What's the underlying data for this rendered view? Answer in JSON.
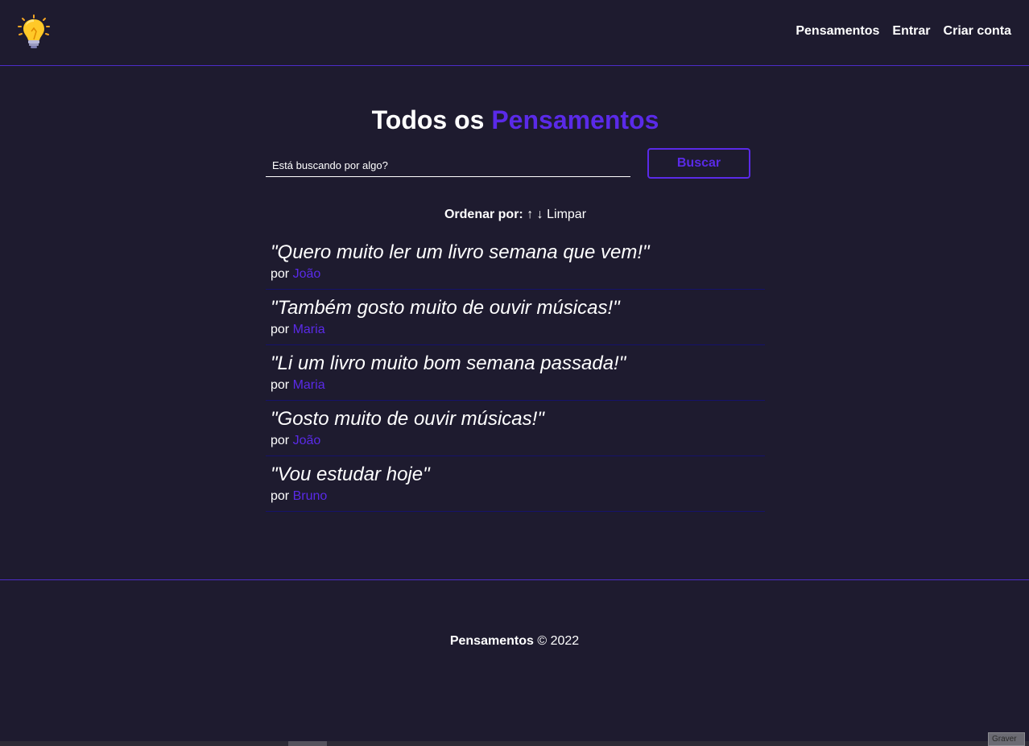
{
  "header": {
    "logo_icon": "lightbulb-icon",
    "nav": [
      {
        "label": "Pensamentos"
      },
      {
        "label": "Entrar"
      },
      {
        "label": "Criar conta"
      }
    ]
  },
  "main": {
    "title_prefix": "Todos os",
    "title_accent": "Pensamentos",
    "search": {
      "placeholder": "Está buscando por algo?",
      "button_label": "Buscar"
    },
    "order": {
      "label": "Ordenar por:",
      "asc": "↑",
      "desc": "↓",
      "clear": "Limpar"
    },
    "thoughts": [
      {
        "text": "\"Quero muito ler um livro semana que vem!\"",
        "by": "por",
        "author": "João"
      },
      {
        "text": "\"Também gosto muito de ouvir músicas!\"",
        "by": "por",
        "author": "Maria"
      },
      {
        "text": "\"Li um livro muito bom semana passada!\"",
        "by": "por",
        "author": "Maria"
      },
      {
        "text": "\"Gosto muito de ouvir músicas!\"",
        "by": "por",
        "author": "João"
      },
      {
        "text": "\"Vou estudar hoje\"",
        "by": "por",
        "author": "Bruno"
      }
    ]
  },
  "footer": {
    "brand": "Pensamentos",
    "copyright": "© 2022"
  },
  "overlay": {
    "record_label": "Graver"
  },
  "colors": {
    "background": "#1e1b2f",
    "accent": "#5a2ae8",
    "divider": "#4d2dc9",
    "row_divider": "#15126a",
    "text": "#ffffff"
  }
}
